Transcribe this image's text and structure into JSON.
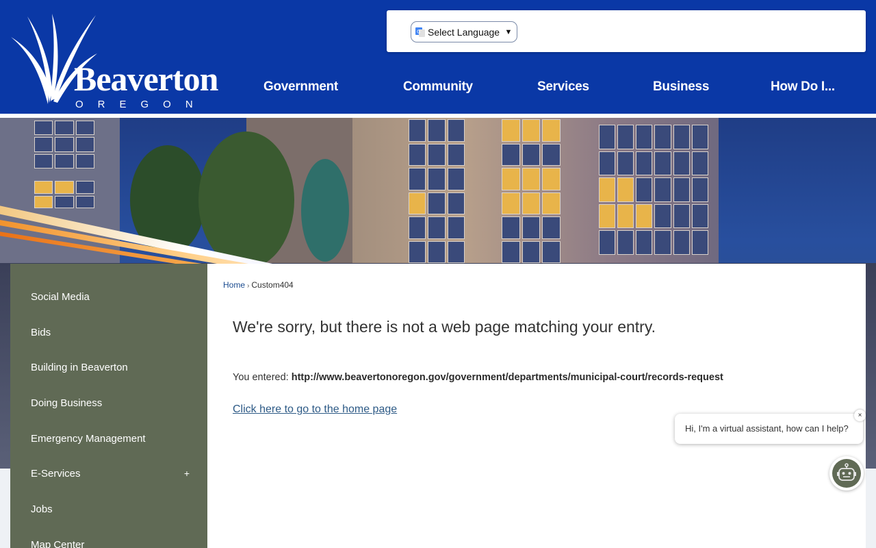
{
  "logo": {
    "wordmark": "Beaverton",
    "subtitle": "OREGON"
  },
  "translate": {
    "icon": "google-translate-icon",
    "selected": "Select Language"
  },
  "nav": {
    "items": [
      {
        "label": "Government"
      },
      {
        "label": "Community"
      },
      {
        "label": "Services"
      },
      {
        "label": "Business"
      },
      {
        "label": "How Do I..."
      }
    ]
  },
  "sidebar": {
    "items": [
      {
        "label": "Social Media"
      },
      {
        "label": "Bids"
      },
      {
        "label": "Building in Beaverton"
      },
      {
        "label": "Doing Business"
      },
      {
        "label": "Emergency Management"
      },
      {
        "label": "E-Services",
        "expand": "+"
      },
      {
        "label": "Jobs"
      },
      {
        "label": "Map Center"
      }
    ]
  },
  "breadcrumb": {
    "home": "Home",
    "separator": "›",
    "current": "Custom404"
  },
  "main": {
    "title": "We're sorry, but there is not a web page matching your entry.",
    "entered_label": "You entered:",
    "entered_url": "http://www.beavertonoregon.gov/government/departments/municipal-court/records-request",
    "home_link": "Click here to go to the home page"
  },
  "chat": {
    "greeting": "Hi, I'm a virtual assistant, how can I help?",
    "close": "×",
    "icon": "robot-icon"
  },
  "colors": {
    "header_blue": "#0a38a6",
    "sidebar_green": "#606a55",
    "link_blue": "#2d5a86"
  }
}
